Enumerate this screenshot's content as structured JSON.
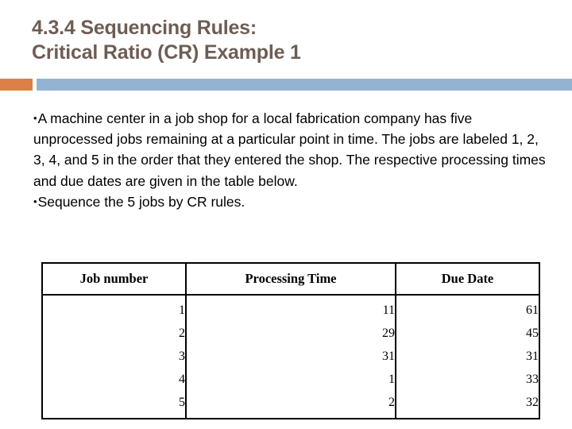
{
  "slide": {
    "title_line1": "4.3.4 Sequencing Rules:",
    "title_line2": "Critical Ratio (CR) Example 1",
    "title_color": "#6E5D55",
    "accent_bar_color": "#DD8047",
    "main_bar_color": "#94B3D1",
    "bullet_glyph": "•",
    "body": {
      "paragraph1": "A machine center in a job shop for a local fabrication company has five unprocessed jobs remaining at a particular point in time. The jobs are labeled 1, 2, 3, 4, and 5 in the order that they entered the shop. The respective processing times and due dates are given in the table below.",
      "paragraph2": "Sequence the 5 jobs by CR rules."
    }
  },
  "table": {
    "headers": [
      "Job number",
      "Processing Time",
      "Due Date"
    ],
    "rows": [
      {
        "job": "1",
        "processing_time": "11",
        "due_date": "61"
      },
      {
        "job": "2",
        "processing_time": "29",
        "due_date": "45"
      },
      {
        "job": "3",
        "processing_time": "31",
        "due_date": "31"
      },
      {
        "job": "4",
        "processing_time": "1",
        "due_date": "33"
      },
      {
        "job": "5",
        "processing_time": "2",
        "due_date": "32"
      }
    ]
  }
}
